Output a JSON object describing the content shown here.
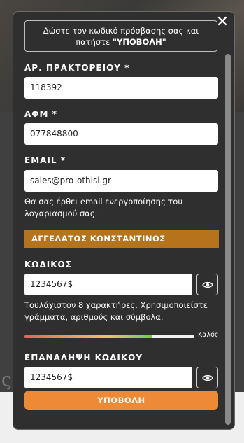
{
  "modal": {
    "close_icon": "close-icon",
    "notice": {
      "line1": "Δώστε τον κωδικό πρόσβασης σας και",
      "line2_prefix": "πατήστε ",
      "line2_bold": "\"ΥΠΟΒΟΛΗ\""
    },
    "agency": {
      "label": "ΑΡ. ΠΡΑΚΤΟΡΕΙΟΥ *",
      "value": "118392"
    },
    "afm": {
      "label": "ΑΦΜ *",
      "value": "077848800"
    },
    "email": {
      "label": "EMAIL *",
      "value": "sales@pro-othisi.gr",
      "hint": "Θα σας έρθει email ενεργοποίησης του λογαριασμού σας."
    },
    "name_banner": "ΑΓΓΕΛΑΤΟΣ ΚΩΝΣΤΑΝΤΙΝΟΣ",
    "password": {
      "label": "ΚΩΔΙΚΟΣ",
      "value": "1234567$",
      "toggle_icon": "eye-icon",
      "hint": "Τουλάχιστον 8 χαρακτήρες. Χρησιμοποιείστε γράμματα, αριθμούς και σύμβολα.",
      "strength_label": "Καλός",
      "strength_level": 0.75
    },
    "password_repeat": {
      "label": "ΕΠΑΝΑΛΗΨΗ ΚΩΔΙΚΟΥ",
      "value": "1234567$",
      "toggle_icon": "eye-icon"
    },
    "submit_label": "ΥΠΟΒΟΛΗ"
  },
  "colors": {
    "modal_bg": "#2f2f2f",
    "banner": "#b5731c",
    "submit": "#ee8a36"
  }
}
